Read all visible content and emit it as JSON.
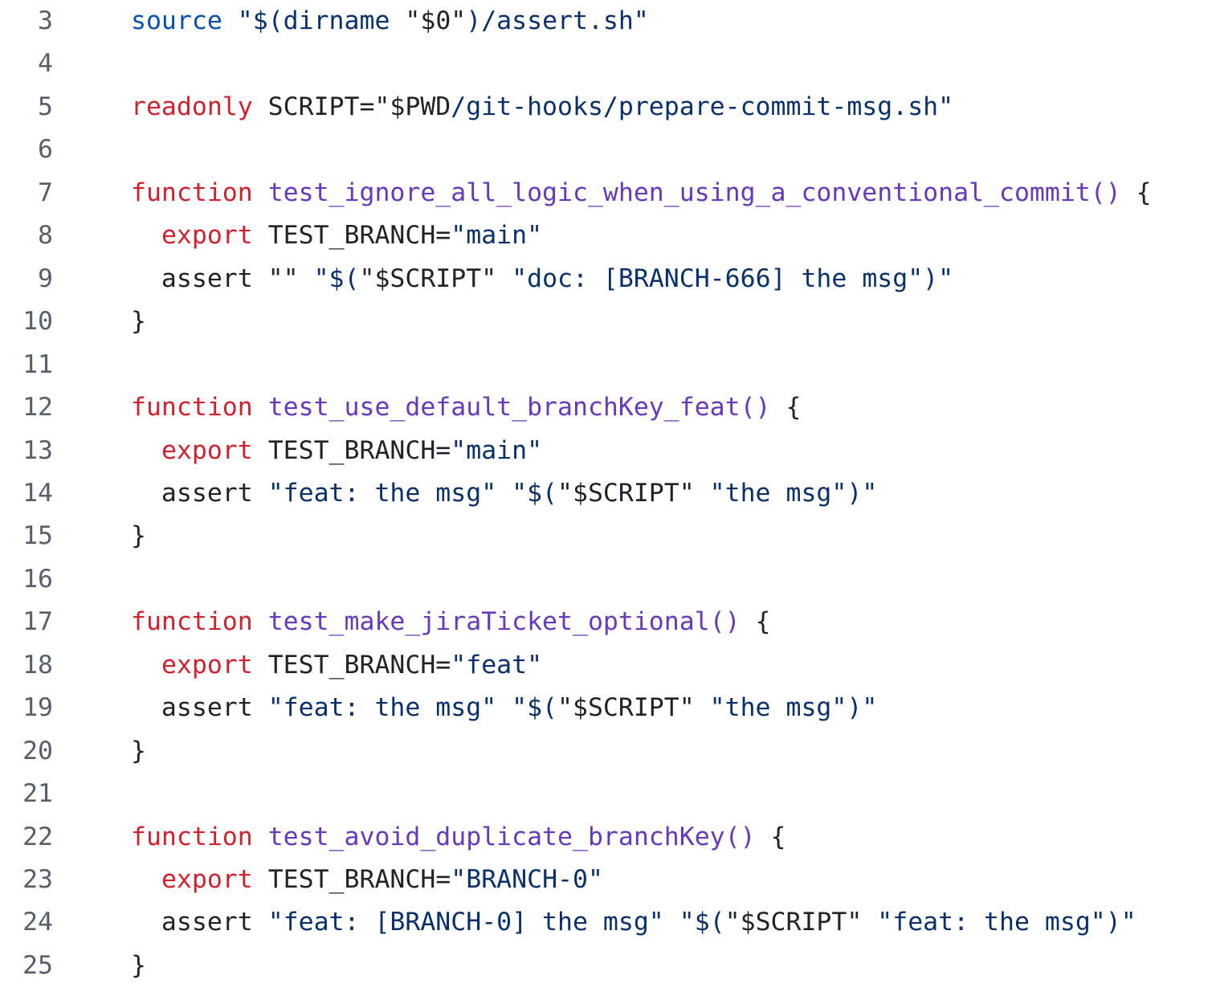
{
  "editor": {
    "colors": {
      "keyword": "#cf222e",
      "function": "#6639ba",
      "string": "#0a3069",
      "builtin": "#0550ae",
      "plain": "#1f2328",
      "line_number": "#57606a"
    },
    "lines": [
      {
        "number": "3",
        "tokens": [
          {
            "t": "builtin",
            "v": "source"
          },
          {
            "t": "plain",
            "v": " "
          },
          {
            "t": "str",
            "v": "\"$(dirname "
          },
          {
            "t": "plain",
            "v": "\"$0\""
          },
          {
            "t": "str",
            "v": ")/assert.sh\""
          }
        ]
      },
      {
        "number": "4",
        "tokens": []
      },
      {
        "number": "5",
        "tokens": [
          {
            "t": "kw",
            "v": "readonly"
          },
          {
            "t": "plain",
            "v": " SCRIPT=\"$PWD"
          },
          {
            "t": "str",
            "v": "/git-hooks/prepare-commit-msg.sh\""
          }
        ]
      },
      {
        "number": "6",
        "tokens": []
      },
      {
        "number": "7",
        "tokens": [
          {
            "t": "kw",
            "v": "function"
          },
          {
            "t": "plain",
            "v": " "
          },
          {
            "t": "fn",
            "v": "test_ignore_all_logic_when_using_a_conventional_commit()"
          },
          {
            "t": "plain",
            "v": " {"
          }
        ]
      },
      {
        "number": "8",
        "tokens": [
          {
            "t": "plain",
            "v": "  "
          },
          {
            "t": "kw",
            "v": "export"
          },
          {
            "t": "plain",
            "v": " TEST_BRANCH="
          },
          {
            "t": "str",
            "v": "\"main\""
          }
        ]
      },
      {
        "number": "9",
        "tokens": [
          {
            "t": "plain",
            "v": "  assert \"\" "
          },
          {
            "t": "str",
            "v": "\"$("
          },
          {
            "t": "plain",
            "v": "\"$SCRIPT\""
          },
          {
            "t": "str",
            "v": " \"doc: [BRANCH-666] the msg\")\""
          }
        ]
      },
      {
        "number": "10",
        "tokens": [
          {
            "t": "plain",
            "v": "}"
          }
        ]
      },
      {
        "number": "11",
        "tokens": []
      },
      {
        "number": "12",
        "tokens": [
          {
            "t": "kw",
            "v": "function"
          },
          {
            "t": "plain",
            "v": " "
          },
          {
            "t": "fn",
            "v": "test_use_default_branchKey_feat()"
          },
          {
            "t": "plain",
            "v": " {"
          }
        ]
      },
      {
        "number": "13",
        "tokens": [
          {
            "t": "plain",
            "v": "  "
          },
          {
            "t": "kw",
            "v": "export"
          },
          {
            "t": "plain",
            "v": " TEST_BRANCH="
          },
          {
            "t": "str",
            "v": "\"main\""
          }
        ]
      },
      {
        "number": "14",
        "tokens": [
          {
            "t": "plain",
            "v": "  assert "
          },
          {
            "t": "str",
            "v": "\"feat: the msg\" \"$("
          },
          {
            "t": "plain",
            "v": "\"$SCRIPT\""
          },
          {
            "t": "str",
            "v": " \"the msg\")\""
          }
        ]
      },
      {
        "number": "15",
        "tokens": [
          {
            "t": "plain",
            "v": "}"
          }
        ]
      },
      {
        "number": "16",
        "tokens": []
      },
      {
        "number": "17",
        "tokens": [
          {
            "t": "kw",
            "v": "function"
          },
          {
            "t": "plain",
            "v": " "
          },
          {
            "t": "fn",
            "v": "test_make_jiraTicket_optional()"
          },
          {
            "t": "plain",
            "v": " {"
          }
        ]
      },
      {
        "number": "18",
        "tokens": [
          {
            "t": "plain",
            "v": "  "
          },
          {
            "t": "kw",
            "v": "export"
          },
          {
            "t": "plain",
            "v": " TEST_BRANCH="
          },
          {
            "t": "str",
            "v": "\"feat\""
          }
        ]
      },
      {
        "number": "19",
        "tokens": [
          {
            "t": "plain",
            "v": "  assert "
          },
          {
            "t": "str",
            "v": "\"feat: the msg\" \"$("
          },
          {
            "t": "plain",
            "v": "\"$SCRIPT\""
          },
          {
            "t": "str",
            "v": " \"the msg\")\""
          }
        ]
      },
      {
        "number": "20",
        "tokens": [
          {
            "t": "plain",
            "v": "}"
          }
        ]
      },
      {
        "number": "21",
        "tokens": []
      },
      {
        "number": "22",
        "tokens": [
          {
            "t": "kw",
            "v": "function"
          },
          {
            "t": "plain",
            "v": " "
          },
          {
            "t": "fn",
            "v": "test_avoid_duplicate_branchKey()"
          },
          {
            "t": "plain",
            "v": " {"
          }
        ]
      },
      {
        "number": "23",
        "tokens": [
          {
            "t": "plain",
            "v": "  "
          },
          {
            "t": "kw",
            "v": "export"
          },
          {
            "t": "plain",
            "v": " TEST_BRANCH="
          },
          {
            "t": "str",
            "v": "\"BRANCH-0\""
          }
        ]
      },
      {
        "number": "24",
        "tokens": [
          {
            "t": "plain",
            "v": "  assert "
          },
          {
            "t": "str",
            "v": "\"feat: [BRANCH-0] the msg\" \"$("
          },
          {
            "t": "plain",
            "v": "\"$SCRIPT\""
          },
          {
            "t": "str",
            "v": " \"feat: the msg\")\""
          }
        ]
      },
      {
        "number": "25",
        "tokens": [
          {
            "t": "plain",
            "v": "}"
          }
        ]
      }
    ]
  }
}
